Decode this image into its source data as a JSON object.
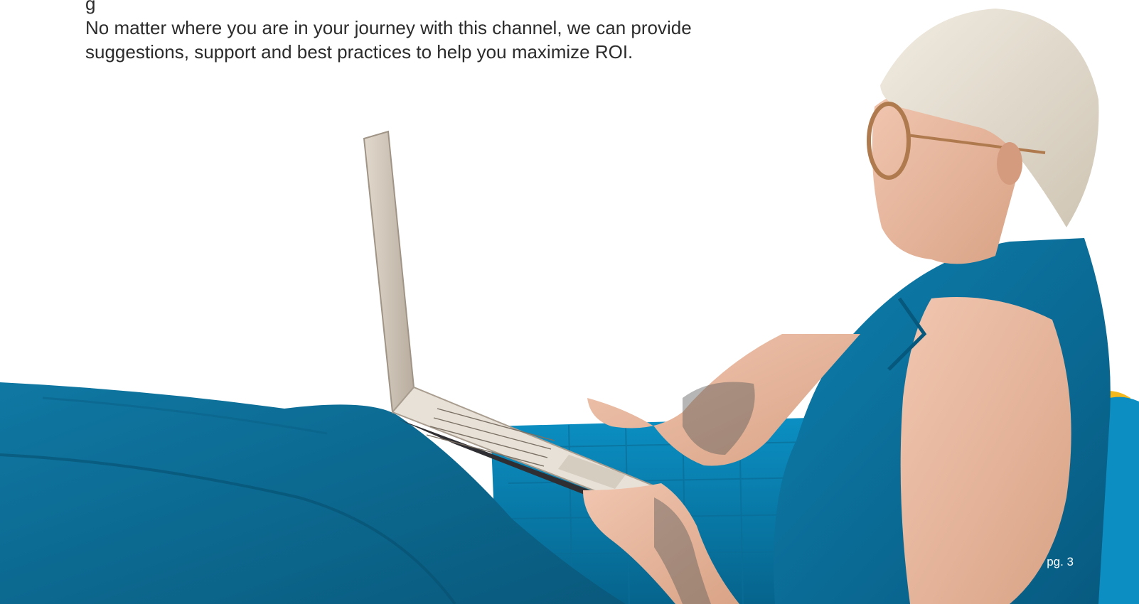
{
  "body": {
    "line_1": "g",
    "line_2": "No matter where you are in your journey with this channel, we can provide",
    "line_3": "suggestions, support and best practices to help you maximize ROI."
  },
  "footer": {
    "page_number": "pg. 3"
  },
  "colors": {
    "text": "#2c2c2c",
    "teal_fabric": "#0d6e96",
    "sofa_blue": "#0a86b8",
    "hair": "#e6dfd3",
    "skin": "#e9b8a0",
    "laptop": "#d9d0c5",
    "accent_yellow": "#f2b81e"
  }
}
